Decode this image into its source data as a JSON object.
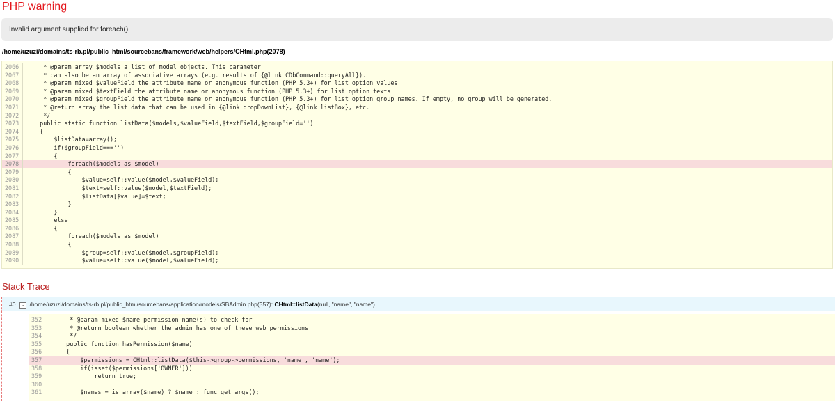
{
  "error": {
    "type": "PHP warning",
    "message": "Invalid argument supplied for foreach()",
    "file": "/home/uzuzi/domains/ts-rb.pl/public_html/sourcebans/framework/web/helpers/CHtml.php(2078)"
  },
  "source": {
    "highlight_line": "2078",
    "lines": [
      {
        "num": "2066",
        "code": "     * @param array $models a list of model objects. This parameter"
      },
      {
        "num": "2067",
        "code": "     * can also be an array of associative arrays (e.g. results of {@link CDbCommand::queryAll})."
      },
      {
        "num": "2068",
        "code": "     * @param mixed $valueField the attribute name or anonymous function (PHP 5.3+) for list option values"
      },
      {
        "num": "2069",
        "code": "     * @param mixed $textField the attribute name or anonymous function (PHP 5.3+) for list option texts"
      },
      {
        "num": "2070",
        "code": "     * @param mixed $groupField the attribute name or anonymous function (PHP 5.3+) for list option group names. If empty, no group will be generated."
      },
      {
        "num": "2071",
        "code": "     * @return array the list data that can be used in {@link dropDownList}, {@link listBox}, etc."
      },
      {
        "num": "2072",
        "code": "     */"
      },
      {
        "num": "2073",
        "code": "    public static function listData($models,$valueField,$textField,$groupField='')"
      },
      {
        "num": "2074",
        "code": "    {"
      },
      {
        "num": "2075",
        "code": "        $listData=array();"
      },
      {
        "num": "2076",
        "code": "        if($groupField==='')"
      },
      {
        "num": "2077",
        "code": "        {"
      },
      {
        "num": "2078",
        "code": "            foreach($models as $model)"
      },
      {
        "num": "2079",
        "code": "            {"
      },
      {
        "num": "2080",
        "code": "                $value=self::value($model,$valueField);"
      },
      {
        "num": "2081",
        "code": "                $text=self::value($model,$textField);"
      },
      {
        "num": "2082",
        "code": "                $listData[$value]=$text;"
      },
      {
        "num": "2083",
        "code": "            }"
      },
      {
        "num": "2084",
        "code": "        }"
      },
      {
        "num": "2085",
        "code": "        else"
      },
      {
        "num": "2086",
        "code": "        {"
      },
      {
        "num": "2087",
        "code": "            foreach($models as $model)"
      },
      {
        "num": "2088",
        "code": "            {"
      },
      {
        "num": "2089",
        "code": "                $group=self::value($model,$groupField);"
      },
      {
        "num": "2090",
        "code": "                $value=self::value($model,$valueField);"
      }
    ]
  },
  "stack_trace": {
    "title": "Stack Trace",
    "frames": [
      {
        "index": "#0",
        "toggle": "-",
        "file": "/home/uzuzi/domains/ts-rb.pl/public_html/sourcebans/application/models/SBAdmin.php(357):",
        "call_class": "CHtml",
        "call_sep": "::",
        "call_method": "listData",
        "call_args": "(null, \"name\", \"name\")",
        "highlight_line": "357",
        "lines": [
          {
            "num": "352",
            "code": "     * @param mixed $name permission name(s) to check for"
          },
          {
            "num": "353",
            "code": "     * @return boolean whether the admin has one of these web permissions"
          },
          {
            "num": "354",
            "code": "     */"
          },
          {
            "num": "355",
            "code": "    public function hasPermission($name)"
          },
          {
            "num": "356",
            "code": "    {"
          },
          {
            "num": "357",
            "code": "        $permissions = CHtml::listData($this->group->permissions, 'name', 'name');"
          },
          {
            "num": "358",
            "code": "        if(isset($permissions['OWNER']))"
          },
          {
            "num": "359",
            "code": "            return true;"
          },
          {
            "num": "360",
            "code": ""
          },
          {
            "num": "361",
            "code": "        $names = is_array($name) ? $name : func_get_args();"
          }
        ]
      }
    ]
  },
  "colors": {
    "title": "#e4171d",
    "message_bg": "#ececec",
    "code_bg": "#ffffe6",
    "highlight_bg": "#f8dcdc",
    "trace_header_bg": "#e8f7fd",
    "trace_border": "#e67878"
  }
}
